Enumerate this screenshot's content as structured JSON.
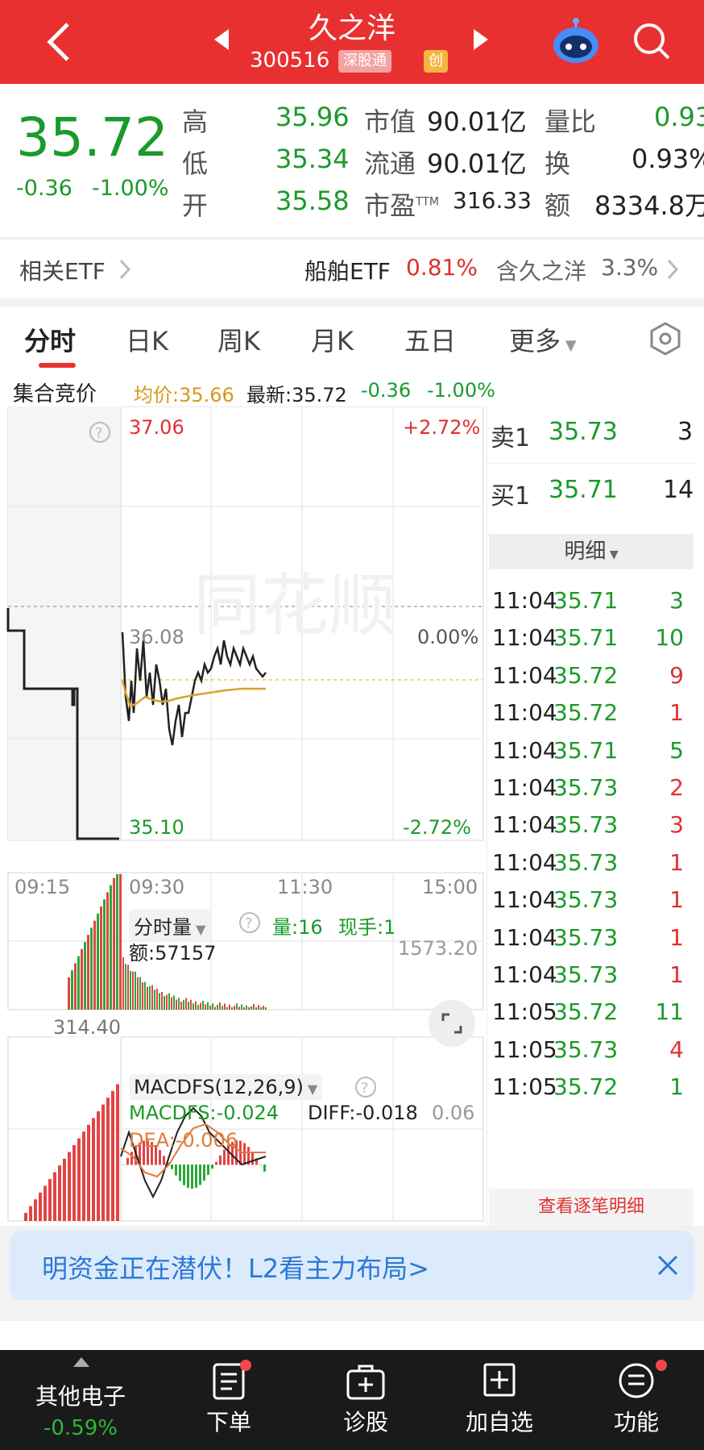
{
  "header": {
    "title": "久之洋",
    "code": "300516",
    "badge_market": "深股通",
    "badge_board": "创",
    "back_icon": "chevron-left-icon",
    "prev_icon": "triangle-left-icon",
    "next_icon": "triangle-right-icon",
    "robot_icon": "robot-icon",
    "search_icon": "search-icon",
    "bg_color": "#e93030"
  },
  "quote": {
    "price": "35.72",
    "change": "-0.36",
    "change_pct": "-1.00%",
    "high_label": "高",
    "high": "35.96",
    "low_label": "低",
    "low": "35.34",
    "open_label": "开",
    "open": "35.58",
    "mktcap_label": "市值",
    "mktcap": "90.01亿",
    "float_label": "流通",
    "float": "90.01亿",
    "pe_label": "市盈",
    "pe_sup": "TTM",
    "pe": "316.33",
    "vol_ratio_label": "量比",
    "vol_ratio": "0.93",
    "turnover_label": "换",
    "turnover": "0.93%",
    "amount_label": "额",
    "amount": "8334.8万"
  },
  "etf": {
    "label": "相关ETF",
    "name": "船舶ETF",
    "pct": "0.81%",
    "holding": "含久之洋",
    "holding_pct": "3.3%"
  },
  "tabs": [
    "分时",
    "日K",
    "周K",
    "月K",
    "五日",
    "更多"
  ],
  "active_tab": 0,
  "info": {
    "auction_label": "集合竞价",
    "avg_label": "均价:35.66",
    "latest_label": "最新:35.72",
    "chg": "-0.36",
    "chg_pct": "-1.00%"
  },
  "price_chart": {
    "top_price": "37.06",
    "top_pct": "+2.72%",
    "mid_price": "36.08",
    "mid_pct": "0.00%",
    "bottom_price": "35.10",
    "bottom_pct": "-2.72%",
    "watermark": "同花顺",
    "times": [
      "09:15",
      "09:30",
      "11:30",
      "15:00"
    ]
  },
  "volume_chart": {
    "selector": "分时量",
    "vol": "量:16",
    "cur": "现手:1",
    "amount": "额:57157",
    "max": "1573.20",
    "left_val": "314.40"
  },
  "macd_chart": {
    "selector": "MACDFS(12,26,9)",
    "macd": "MACDFS:-0.024",
    "diff": "DIFF:-0.018",
    "dea": "DEA:-0.006",
    "max": "0.06"
  },
  "orderbook": {
    "ask_label": "卖1",
    "ask_price": "35.73",
    "ask_vol": "3",
    "bid_label": "买1",
    "bid_price": "35.71",
    "bid_vol": "14",
    "detail_label": "明细",
    "view_all": "查看逐笔明细",
    "ticks": [
      {
        "time": "11:04",
        "price": "35.71",
        "vol": "3",
        "dir": "buy"
      },
      {
        "time": "11:04",
        "price": "35.71",
        "vol": "10",
        "dir": "buy"
      },
      {
        "time": "11:04",
        "price": "35.72",
        "vol": "9",
        "dir": "sell"
      },
      {
        "time": "11:04",
        "price": "35.72",
        "vol": "1",
        "dir": "sell"
      },
      {
        "time": "11:04",
        "price": "35.71",
        "vol": "5",
        "dir": "buy"
      },
      {
        "time": "11:04",
        "price": "35.73",
        "vol": "2",
        "dir": "sell"
      },
      {
        "time": "11:04",
        "price": "35.73",
        "vol": "3",
        "dir": "sell"
      },
      {
        "time": "11:04",
        "price": "35.73",
        "vol": "1",
        "dir": "sell"
      },
      {
        "time": "11:04",
        "price": "35.73",
        "vol": "1",
        "dir": "sell"
      },
      {
        "time": "11:04",
        "price": "35.73",
        "vol": "1",
        "dir": "sell"
      },
      {
        "time": "11:04",
        "price": "35.73",
        "vol": "1",
        "dir": "sell"
      },
      {
        "time": "11:05",
        "price": "35.72",
        "vol": "11",
        "dir": "buy"
      },
      {
        "time": "11:05",
        "price": "35.73",
        "vol": "4",
        "dir": "sell"
      },
      {
        "time": "11:05",
        "price": "35.72",
        "vol": "1",
        "dir": "buy"
      }
    ]
  },
  "banner": {
    "text": "明资金正在潜伏！L2看主力布局>",
    "close_icon": "close-icon"
  },
  "bottom_nav": {
    "sector": "其他电子",
    "sector_pct": "-0.59%",
    "order": "下单",
    "diagnose": "诊股",
    "add_watch": "加自选",
    "more": "功能"
  }
}
